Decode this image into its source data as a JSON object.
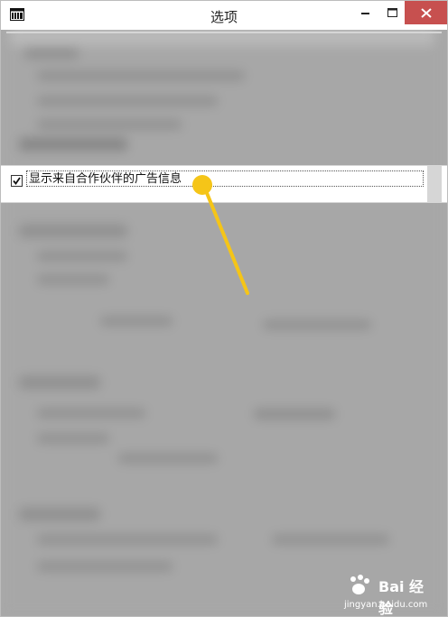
{
  "window": {
    "title": "选项",
    "controls": {
      "minimize": "minimize-icon",
      "maximize": "maximize-icon",
      "close": "close-icon"
    },
    "close_color": "#c7504f"
  },
  "option": {
    "label": "显示来自合作伙伴的广告信息",
    "checked": true
  },
  "annotation": {
    "color": "#f5c518"
  },
  "watermark": {
    "brand": "Bai 经验",
    "url": "jingyan.baidu.com"
  }
}
